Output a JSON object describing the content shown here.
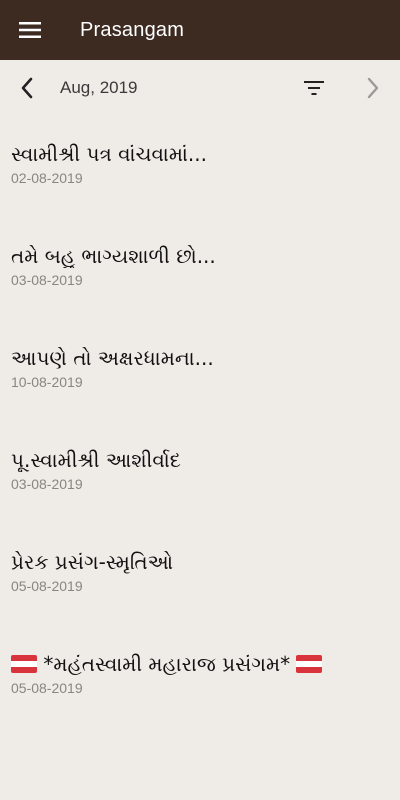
{
  "app": {
    "title": "Prasangam"
  },
  "header": {
    "menu_icon": "menu-icon",
    "month_label": "Aug, 2019",
    "prev_icon": "chevron-left-icon",
    "filter_icon": "filter-icon",
    "next_icon": "chevron-right-icon"
  },
  "list": {
    "items": [
      {
        "title": "સ્વામીશ્રી પત્ર વાંચવામાં...",
        "date": "02-08-2019"
      },
      {
        "title": "તમે બહુ ભાગ્યશાળી છો...",
        "date": "03-08-2019"
      },
      {
        "title": "આપણે તો અક્ષરધામના...",
        "date": "10-08-2019"
      },
      {
        "title": "પૂ.સ્વામીશ્રી આશીર્વાદ",
        "date": "03-08-2019"
      },
      {
        "title": "પ્રેરક પ્રસંગ-સ્મૃતિઓ",
        "date": "05-08-2019"
      },
      {
        "title": "*મહંતસ્વામી મહારાજ પ્રસંગમ*",
        "date": "05-08-2019",
        "flag_icon": "flag-icon"
      }
    ]
  },
  "colors": {
    "appbar": "#3d2b22",
    "background": "#efebe7",
    "date_text": "#8a8580"
  }
}
